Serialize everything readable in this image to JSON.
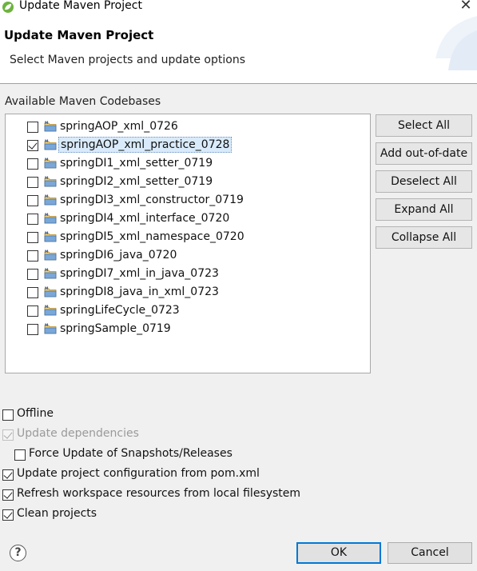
{
  "window": {
    "title": "Update Maven Project",
    "app_icon": "spring-leaf-icon",
    "close_glyph": "✕"
  },
  "header": {
    "title": "Update Maven Project",
    "description": "Select Maven projects and update options"
  },
  "codebases": {
    "label": "Available Maven Codebases",
    "items": [
      {
        "name": "springAOP_xml_0726",
        "checked": false,
        "selected": false
      },
      {
        "name": "springAOP_xml_practice_0728",
        "checked": true,
        "selected": true
      },
      {
        "name": "springDI1_xml_setter_0719",
        "checked": false,
        "selected": false
      },
      {
        "name": "springDI2_xml_setter_0719",
        "checked": false,
        "selected": false
      },
      {
        "name": "springDI3_xml_constructor_0719",
        "checked": false,
        "selected": false
      },
      {
        "name": "springDI4_xml_interface_0720",
        "checked": false,
        "selected": false
      },
      {
        "name": "springDI5_xml_namespace_0720",
        "checked": false,
        "selected": false
      },
      {
        "name": "springDI6_java_0720",
        "checked": false,
        "selected": false
      },
      {
        "name": "springDI7_xml_in_java_0723",
        "checked": false,
        "selected": false
      },
      {
        "name": "springDI8_java_in_xml_0723",
        "checked": false,
        "selected": false
      },
      {
        "name": "springLifeCycle_0723",
        "checked": false,
        "selected": false
      },
      {
        "name": "springSample_0719",
        "checked": false,
        "selected": false
      }
    ]
  },
  "side_buttons": {
    "select_all": "Select All",
    "add_out_of_date": "Add out-of-date",
    "deselect_all": "Deselect All",
    "expand_all": "Expand All",
    "collapse_all": "Collapse All"
  },
  "options": {
    "offline": {
      "label": "Offline",
      "checked": false
    },
    "update_dependencies": {
      "label": "Update dependencies",
      "checked": true,
      "disabled": true
    },
    "force_update": {
      "label": "Force Update of Snapshots/Releases",
      "checked": false
    },
    "update_config": {
      "label": "Update project configuration from pom.xml",
      "checked": true
    },
    "refresh_workspace": {
      "label": "Refresh workspace resources from local filesystem",
      "checked": true
    },
    "clean_projects": {
      "label": "Clean projects",
      "checked": true
    }
  },
  "footer": {
    "help_glyph": "?",
    "ok": "OK",
    "cancel": "Cancel"
  },
  "colors": {
    "accent": "#0078d7",
    "selection_bg": "#d9ebfb"
  }
}
